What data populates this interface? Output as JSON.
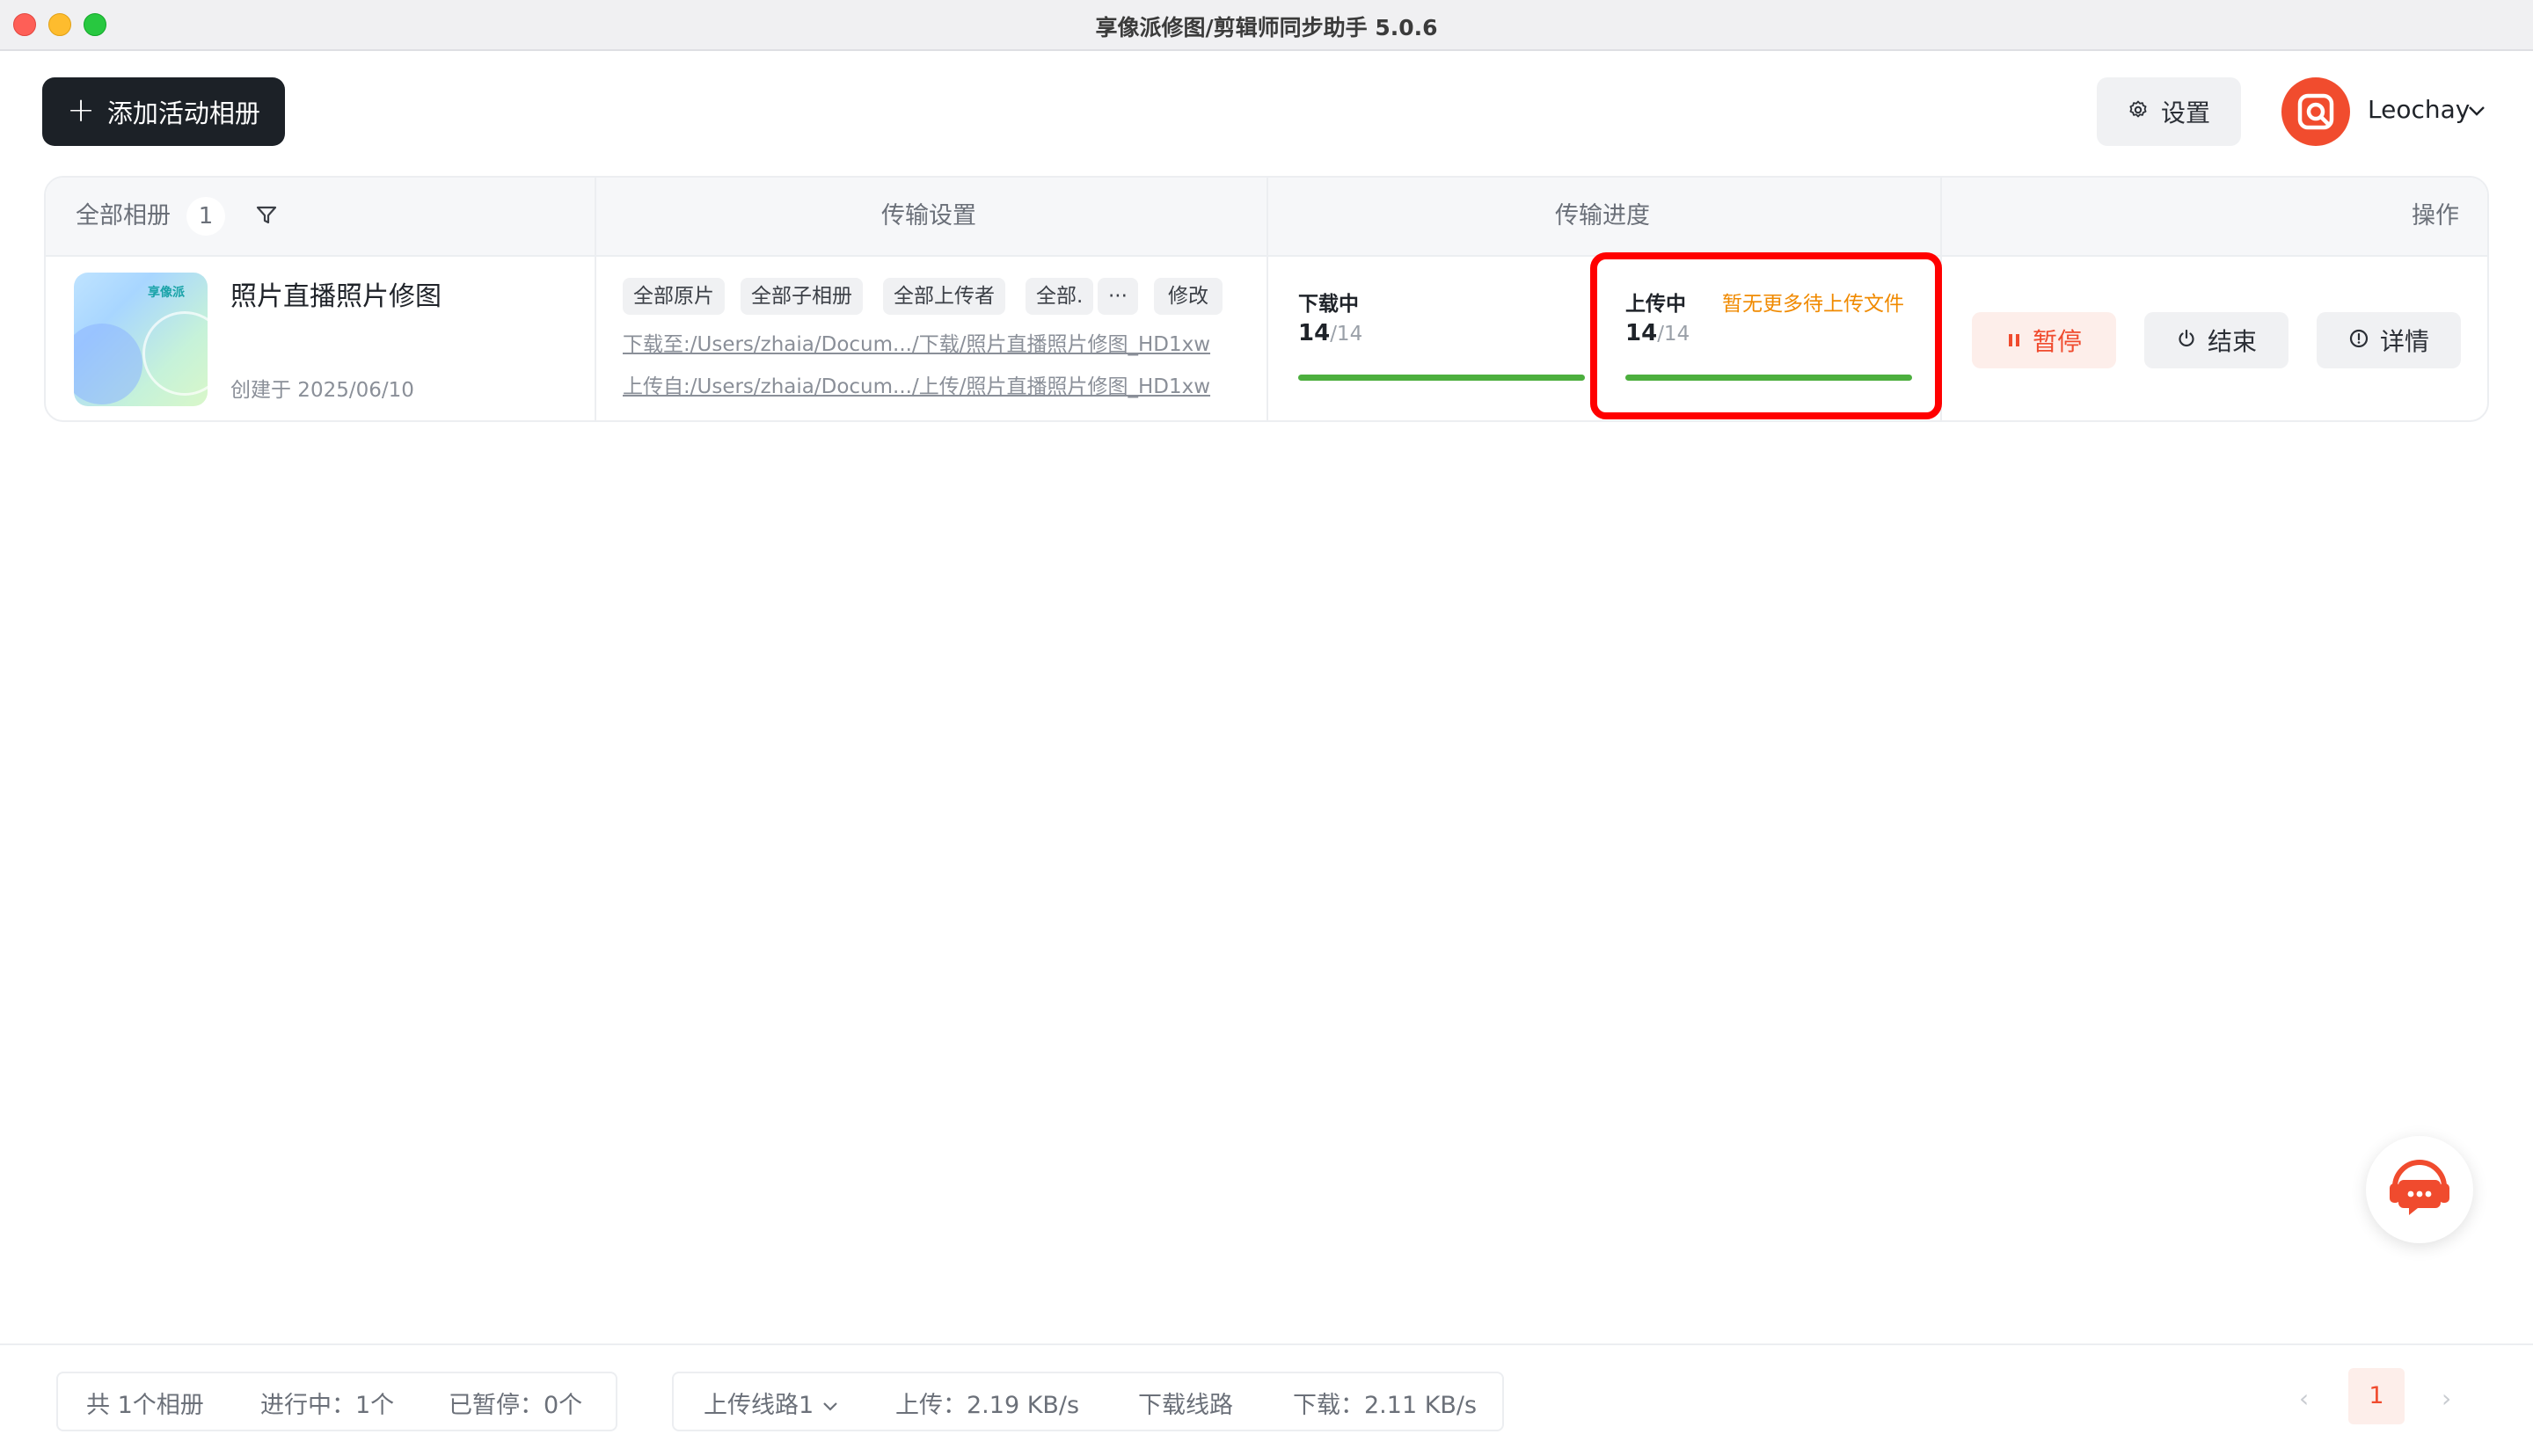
{
  "window": {
    "title": "享像派修图/剪辑师同步助手 5.0.6"
  },
  "header": {
    "add_album_label": "添加活动相册",
    "settings_label": "设置",
    "username": "Leochay"
  },
  "table": {
    "columns": {
      "all_albums": "全部相册",
      "album_count": "1",
      "transfer_settings": "传输设置",
      "transfer_progress": "传输进度",
      "actions": "操作"
    },
    "row": {
      "thumbnail_brand": "享像派",
      "name": "照片直播照片修图",
      "created": "创建于 2025/06/10",
      "tags": [
        "全部原片",
        "全部子相册",
        "全部上传者",
        "全部.",
        "···"
      ],
      "edit_label": "修改",
      "download_path": "下载至:/Users/zhaia/Docum.../下载/照片直播照片修图_HD1xw",
      "upload_path": "上传自:/Users/zhaia/Docum.../上传/照片直播照片修图_HD1xw",
      "download": {
        "status": "下载中",
        "done": "14",
        "total": "/14",
        "progress": 1.0
      },
      "upload": {
        "status": "上传中",
        "note": "暂无更多待上传文件",
        "done": "14",
        "total": "/14",
        "progress": 1.0
      },
      "actions": {
        "pause": "暂停",
        "end": "结束",
        "detail": "详情"
      }
    }
  },
  "footer": {
    "total_albums": "共 1个相册",
    "in_progress": "进行中：1个",
    "paused": "已暂停：0个",
    "upload_route": "上传线路1",
    "upload_speed": "上传：2.19 KB/s",
    "download_route": "下载线路",
    "download_speed": "下载：2.11 KB/s",
    "current_page": "1",
    "prev": "‹",
    "next": "›"
  },
  "colors": {
    "accent": "#f04b2e",
    "progress": "#4caf3e",
    "note": "#f08a00",
    "highlight": "#ff0000"
  },
  "icons": [
    "plus-icon",
    "gear-icon",
    "chevron-down-icon",
    "filter-icon",
    "pause-icon",
    "power-icon",
    "info-icon",
    "support-chat-icon"
  ]
}
